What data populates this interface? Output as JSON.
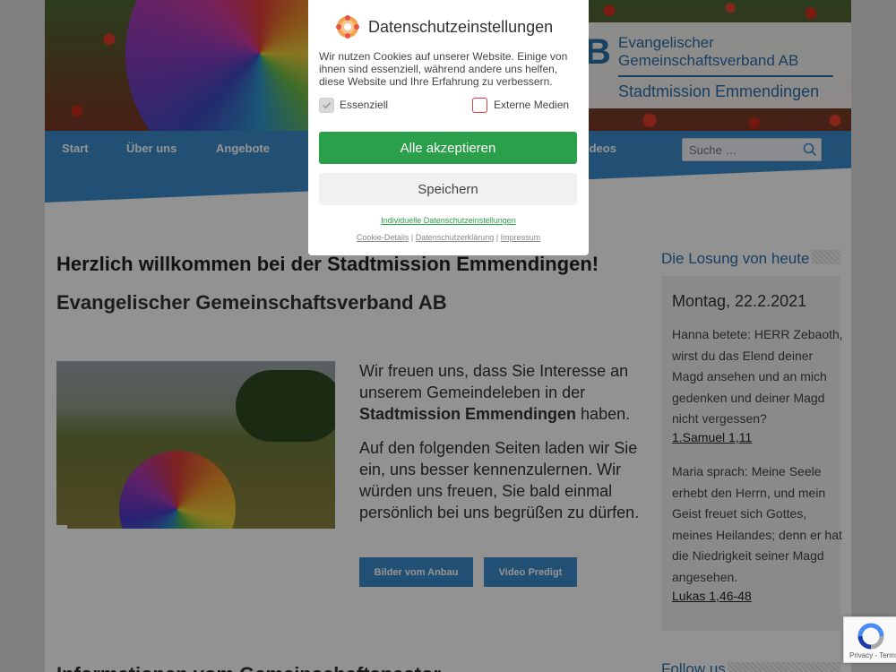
{
  "header": {
    "logo_line1": "Evangelischer",
    "logo_line2": "Gemeinschaftsverband AB",
    "logo_line3": "Stadtmission Emmendingen",
    "logo_mark": "B"
  },
  "nav": {
    "items": [
      "Start",
      "Über uns",
      "Angebote",
      "ideos"
    ],
    "search_placeholder": "Suche …"
  },
  "main": {
    "title": "Herzlich willkommen bei der Stadtmission Emmendingen!",
    "subtitle": "Evangelischer Gemeinschaftsverband AB",
    "para1_pre": "Wir freuen uns, dass Sie Interesse an unserem Gemeindeleben in der ",
    "para1_bold": "Stadtmission Emmendingen",
    "para1_post": " haben.",
    "para2": "Auf den folgenden Seiten laden wir Sie ein, uns besser kennenzulernen. Wir würden uns freuen, Sie bald einmal persönlich bei uns begrüßen zu dürfen.",
    "button1": "Bilder vom Anbau",
    "button2": "Video Predigt",
    "section_heading": "Informationen vom Gemeinschaftspastor"
  },
  "sidebar": {
    "title": "Die Losung von heute",
    "date": "Montag, 22.2.2021",
    "verse1": "Hanna betete: HERR Zebaoth, wirst du das Elend deiner Magd ansehen und an mich gedenken und deiner Magd nicht vergessen?",
    "ref1": "1.Samuel 1,11",
    "verse2": "Maria sprach: Meine Seele erhebt den Herrn, und mein Geist freuet sich Gottes, meines Heilandes; denn er hat die Niedrigkeit seiner Magd angesehen.",
    "ref2": "Lukas 1,46-48",
    "follow_title": "Follow us"
  },
  "cookie_dialog": {
    "title": "Datenschutzeinstellungen",
    "text": "Wir nutzen Cookies auf unserer Website. Einige von ihnen sind essenziell, während andere uns helfen, diese Website und Ihre Erfahrung zu verbessern.",
    "essential_label": "Essenziell",
    "external_label": "Externe Medien",
    "essential_checked": true,
    "external_checked": false,
    "accept_all": "Alle akzeptieren",
    "save": "Speichern",
    "individual_link": "Individuelle Datenschutzeinstellungen",
    "footer_links": [
      "Cookie-Details",
      "Datenschutzerklärung",
      "Impressum"
    ],
    "accent_color": "#2aa04a",
    "unchecked_border_color": "#d94040"
  },
  "recaptcha": {
    "links": "Privacy - Terms"
  },
  "colors": {
    "brand_blue": "#3a8ac8",
    "heading_blue": "#2a6ea8"
  }
}
